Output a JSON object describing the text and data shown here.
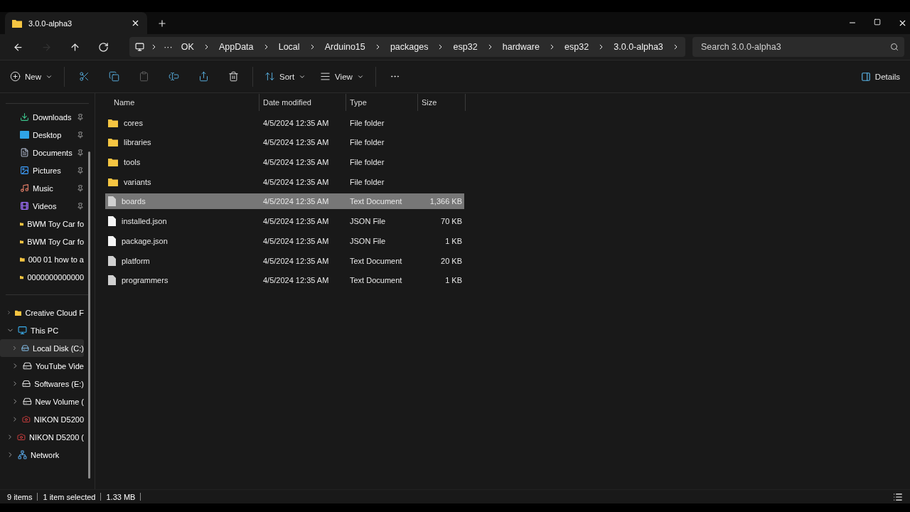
{
  "tabs": [
    {
      "title": "3.0.0-alpha3",
      "selected": true
    }
  ],
  "nav": [
    {
      "kind": "back",
      "disabled": false
    },
    {
      "kind": "forward",
      "disabled": true
    },
    {
      "kind": "up",
      "disabled": false
    },
    {
      "kind": "refresh",
      "disabled": false
    }
  ],
  "breadcrumb": {
    "overflow": "···",
    "parts": [
      "OK",
      "AppData",
      "Local",
      "Arduino15",
      "packages",
      "esp32",
      "hardware",
      "esp32",
      "3.0.0-alpha3"
    ]
  },
  "search": {
    "placeholder": "Search 3.0.0-alpha3"
  },
  "toolbar": [
    {
      "kind": "new",
      "label": "New",
      "disabled": false
    },
    {
      "kind": "cut",
      "disabled": false
    },
    {
      "kind": "copy",
      "disabled": false
    },
    {
      "kind": "paste",
      "disabled": true
    },
    {
      "kind": "rename",
      "disabled": false
    },
    {
      "kind": "share",
      "disabled": false
    },
    {
      "kind": "delete",
      "disabled": false
    },
    {
      "kind": "sort",
      "label": "Sort",
      "disabled": false
    },
    {
      "kind": "view",
      "label": "View",
      "disabled": false
    },
    {
      "kind": "more",
      "disabled": false
    }
  ],
  "details_button": "Details",
  "quick_access": [
    {
      "label": "Downloads",
      "kind": "download",
      "pinned": true
    },
    {
      "label": "Desktop",
      "kind": "desktop",
      "pinned": true
    },
    {
      "label": "Documents",
      "kind": "document",
      "pinned": true
    },
    {
      "label": "Pictures",
      "kind": "picture",
      "pinned": true
    },
    {
      "label": "Music",
      "kind": "music",
      "pinned": true
    },
    {
      "label": "Videos",
      "kind": "video",
      "pinned": true
    },
    {
      "label": "BWM Toy Car fo",
      "kind": "folder",
      "pinned": false
    },
    {
      "label": "BWM Toy Car fo",
      "kind": "folder",
      "pinned": false
    },
    {
      "label": "000 01 how to a",
      "kind": "folder",
      "pinned": false
    },
    {
      "label": "0000000000000",
      "kind": "folder",
      "pinned": false
    }
  ],
  "tree": [
    {
      "label": "Creative Cloud F",
      "kind": "folder",
      "expanded": false,
      "selected": false
    },
    {
      "label": "This PC",
      "kind": "pc",
      "expanded": true,
      "selected": false,
      "children": [
        {
          "label": "Local Disk (C:)",
          "kind": "system-drive",
          "expanded": false,
          "selected": true
        },
        {
          "label": "YouTube Vide",
          "kind": "drive",
          "expanded": false,
          "selected": false
        },
        {
          "label": "Softwares (E:)",
          "kind": "drive",
          "expanded": false,
          "selected": false
        },
        {
          "label": "New Volume (",
          "kind": "drive",
          "expanded": false,
          "selected": false
        },
        {
          "label": "NIKON D5200",
          "kind": "camera",
          "expanded": false,
          "selected": false
        }
      ]
    },
    {
      "label": "NIKON D5200 (",
      "kind": "camera",
      "expanded": false,
      "selected": false
    },
    {
      "label": "Network",
      "kind": "network",
      "expanded": false,
      "selected": false
    }
  ],
  "columns": [
    "Name",
    "Date modified",
    "Type",
    "Size"
  ],
  "rows": [
    {
      "name": "cores",
      "date": "4/5/2024 12:35 AM",
      "type": "File folder",
      "kind": "folder",
      "selected": false
    },
    {
      "name": "libraries",
      "date": "4/5/2024 12:35 AM",
      "type": "File folder",
      "kind": "folder",
      "selected": false
    },
    {
      "name": "tools",
      "date": "4/5/2024 12:35 AM",
      "type": "File folder",
      "kind": "folder",
      "selected": false
    },
    {
      "name": "variants",
      "date": "4/5/2024 12:35 AM",
      "type": "File folder",
      "kind": "folder",
      "selected": false
    },
    {
      "name": "boards",
      "date": "4/5/2024 12:35 AM",
      "type": "Text Document",
      "size": "1,366 KB",
      "kind": "text",
      "selected": true
    },
    {
      "name": "installed.json",
      "date": "4/5/2024 12:35 AM",
      "type": "JSON File",
      "size": "70 KB",
      "kind": "json",
      "selected": false
    },
    {
      "name": "package.json",
      "date": "4/5/2024 12:35 AM",
      "type": "JSON File",
      "size": "1 KB",
      "kind": "json",
      "selected": false
    },
    {
      "name": "platform",
      "date": "4/5/2024 12:35 AM",
      "type": "Text Document",
      "size": "20 KB",
      "kind": "text",
      "selected": false
    },
    {
      "name": "programmers",
      "date": "4/5/2024 12:35 AM",
      "type": "Text Document",
      "size": "1 KB",
      "kind": "text",
      "selected": false
    }
  ],
  "status": [
    "9 items",
    "1 item selected",
    "1.33 MB"
  ]
}
